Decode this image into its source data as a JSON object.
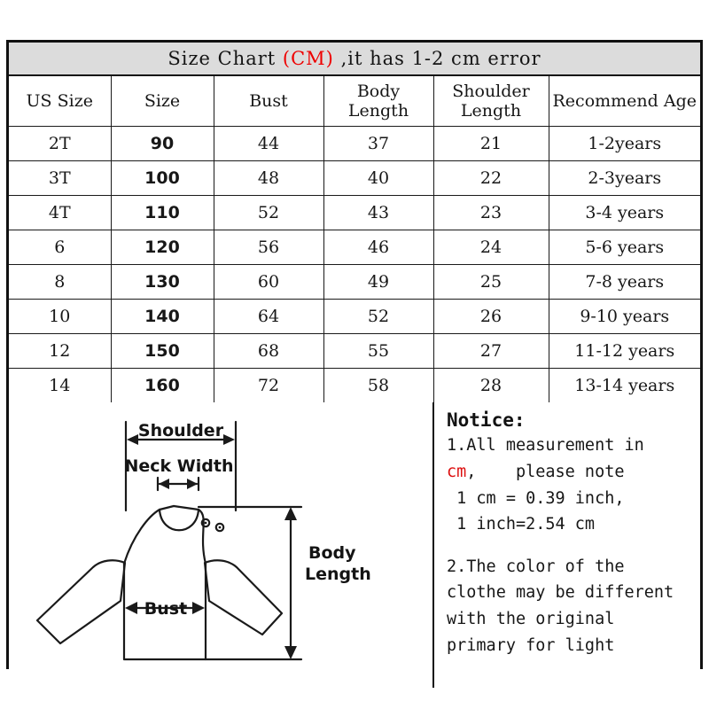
{
  "title": {
    "prefix": "Size Chart ",
    "unit": "(CM)",
    "suffix": " ,it has 1-2 cm error"
  },
  "table": {
    "headers": [
      {
        "line1": "US Size",
        "line2": ""
      },
      {
        "line1": "Size",
        "line2": ""
      },
      {
        "line1": "Bust",
        "line2": ""
      },
      {
        "line1": "Body",
        "line2": "Length"
      },
      {
        "line1": "Shoulder",
        "line2": "Length"
      },
      {
        "line1": "Recommend Age",
        "line2": ""
      }
    ],
    "rows": [
      {
        "us": "2T",
        "size": "90",
        "bust": "44",
        "body": "37",
        "shoulder": "21",
        "age": "1-2years"
      },
      {
        "us": "3T",
        "size": "100",
        "bust": "48",
        "body": "40",
        "shoulder": "22",
        "age": "2-3years"
      },
      {
        "us": "4T",
        "size": "110",
        "bust": "52",
        "body": "43",
        "shoulder": "23",
        "age": "3-4 years"
      },
      {
        "us": "6",
        "size": "120",
        "bust": "56",
        "body": "46",
        "shoulder": "24",
        "age": "5-6 years"
      },
      {
        "us": "8",
        "size": "130",
        "bust": "60",
        "body": "49",
        "shoulder": "25",
        "age": "7-8 years"
      },
      {
        "us": "10",
        "size": "140",
        "bust": "64",
        "body": "52",
        "shoulder": "26",
        "age": "9-10 years"
      },
      {
        "us": "12",
        "size": "150",
        "bust": "68",
        "body": "55",
        "shoulder": "27",
        "age": "11-12 years"
      },
      {
        "us": "14",
        "size": "160",
        "bust": "72",
        "body": "58",
        "shoulder": "28",
        "age": "13-14 years"
      }
    ]
  },
  "diagram": {
    "labels": {
      "shoulder": "Shoulder",
      "neck_width": "Neck Width",
      "bust": "Bust",
      "body_length_1": "Body",
      "body_length_2": "Length"
    }
  },
  "notice": {
    "heading": "Notice:",
    "item1_line1": "1.All measurement in",
    "item1_unit": "cm",
    "item1_line2_rest": ",    please note",
    "item1_line3": " 1 cm = 0.39 inch,",
    "item1_line4": " 1 inch=2.54 cm",
    "item2_line1": "2.The color of the",
    "item2_line2": "clothe may be different",
    "item2_line3": "with the original",
    "item2_line4": "primary for light"
  },
  "colors": {
    "accent_red": "#ee0000",
    "border": "#111111",
    "title_bg": "#dcdcdc"
  }
}
